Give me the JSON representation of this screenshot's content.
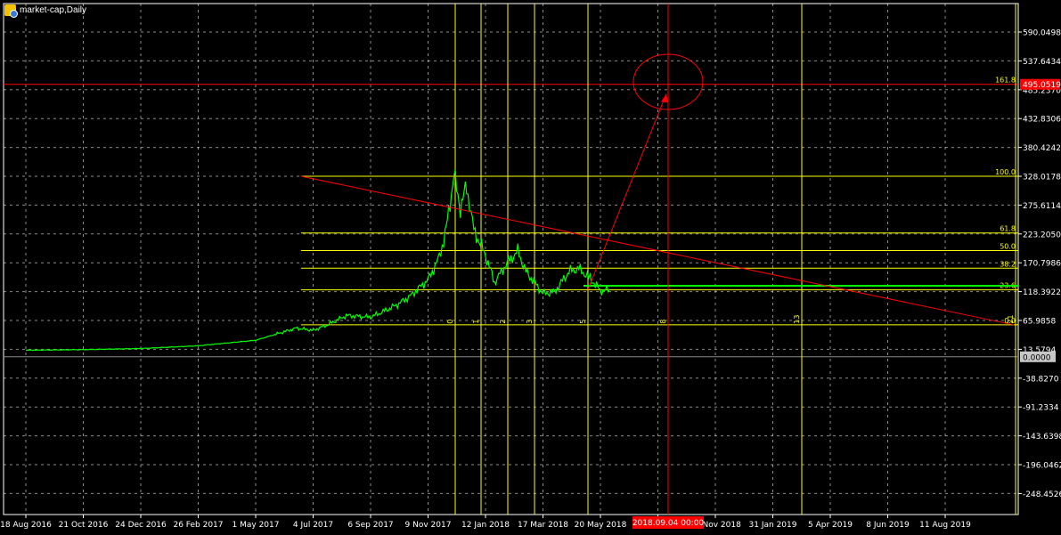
{
  "window": {
    "title": "market-cap,Daily",
    "icon": "chart-window-icon"
  },
  "chart_data": {
    "type": "line",
    "price_axis_labels": [
      "590.0498",
      "537.6434",
      "485.2370",
      "432.8306",
      "380.4242",
      "328.0178",
      "275.6114",
      "223.2050",
      "170.7986",
      "118.3922",
      "65.9858",
      "13.5794",
      "-38.8270",
      "-91.2334",
      "-143.6398",
      "-196.0462",
      "-248.4526"
    ],
    "date_axis_labels": [
      "18 Aug 2016",
      "21 Oct 2016",
      "24 Dec 2016",
      "26 Feb 2017",
      "1 May 2017",
      "4 Jul 2017",
      "6 Sep 2017",
      "9 Nov 2017",
      "12 Jan 2018",
      "17 Mar 2018",
      "20 May 2018",
      "…ep 2018",
      "28 Nov 2018",
      "31 Jan 2019",
      "5 Apr 2019",
      "8 Jun 2019",
      "11 Aug 2019"
    ],
    "crosshair_price": "495.0519",
    "crosshair_time": "2018.09.04 00:00",
    "zero_level": "0.0000",
    "fib_levels": [
      {
        "label": "161.8",
        "value": 495.05
      },
      {
        "label": "100.0",
        "value": 328.0
      },
      {
        "label": "61.8",
        "value": 225.0
      },
      {
        "label": "50.0",
        "value": 193.0
      },
      {
        "label": "38.2",
        "value": 161.0
      },
      {
        "label": "23.6",
        "value": 121.5
      },
      {
        "label": "0.0",
        "value": 58.0
      }
    ],
    "fib_time_labels": [
      "0",
      "1",
      "2",
      "3",
      "5",
      "8",
      "13",
      "21"
    ],
    "series": [
      {
        "color": "#00ff00",
        "points": [
          [
            "18 Aug 2016",
            12
          ],
          [
            "21 Oct 2016",
            13
          ],
          [
            "24 Dec 2016",
            15
          ],
          [
            "26 Feb 2017",
            20
          ],
          [
            "1 May 2017",
            30
          ],
          [
            "15 Jun 2017",
            52
          ],
          [
            "4 Jul 2017",
            48
          ],
          [
            "20 Jul 2017",
            58
          ],
          [
            "10 Aug 2017",
            75
          ],
          [
            "6 Sep 2017",
            72
          ],
          [
            "20 Sep 2017",
            82
          ],
          [
            "6 Oct 2017",
            95
          ],
          [
            "20 Oct 2017",
            110
          ],
          [
            "9 Nov 2017",
            140
          ],
          [
            "20 Nov 2017",
            175
          ],
          [
            "28 Nov 2017",
            220
          ],
          [
            "2 Dec 2017",
            265
          ],
          [
            "8 Dec 2017",
            330
          ],
          [
            "15 Dec 2017",
            270
          ],
          [
            "22 Dec 2017",
            310
          ],
          [
            "30 Dec 2017",
            230
          ],
          [
            "12 Jan 2018",
            185
          ],
          [
            "22 Jan 2018",
            135
          ],
          [
            "5 Feb 2018",
            170
          ],
          [
            "17 Feb 2018",
            192
          ],
          [
            "26 Feb 2018",
            155
          ],
          [
            "17 Mar 2018",
            115
          ],
          [
            "30 Mar 2018",
            118
          ],
          [
            "15 Apr 2018",
            155
          ],
          [
            "26 Apr 2018",
            160
          ],
          [
            "10 May 2018",
            140
          ],
          [
            "20 May 2018",
            120
          ],
          [
            "30 May 2018",
            122
          ]
        ]
      }
    ],
    "support_line_value": 129,
    "grid": true,
    "background": "#000000",
    "grid_color": "#ffffff",
    "fib_color": "#ffff00",
    "trend_color": "#ff0000"
  }
}
